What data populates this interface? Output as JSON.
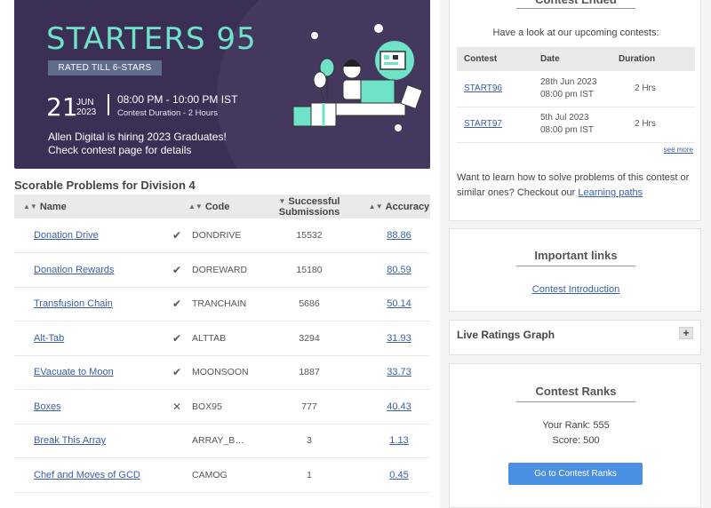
{
  "banner": {
    "title": "STARTERS 95",
    "rated_badge": "RATED TILL 6-STARS",
    "day": "21",
    "month": "JUN",
    "year": "2023",
    "time_range": "08:00 PM - 10:00 PM IST",
    "duration": "Contest Duration - 2 Hours",
    "hiring_line1": "Allen Digital is hiring 2023 Graduates!",
    "hiring_line2": "Check contest page for details"
  },
  "problems": {
    "section_title": "Scorable Problems for Division 4",
    "headers": {
      "name": "Name",
      "code": "Code",
      "submissions": "Successful Submissions",
      "accuracy": "Accuracy"
    },
    "rows": [
      {
        "name": "Donation Drive",
        "status": "✔",
        "code": "DONDRIVE",
        "subs": "15532",
        "acc": "88.86"
      },
      {
        "name": "Donation Rewards",
        "status": "✔",
        "code": "DOREWARD",
        "subs": "15180",
        "acc": "80.59"
      },
      {
        "name": "Transfusion Chain",
        "status": "✔",
        "code": "TRANCHAIN",
        "subs": "5686",
        "acc": "50.14"
      },
      {
        "name": "Alt-Tab",
        "status": "✔",
        "code": "ALTTAB",
        "subs": "3294",
        "acc": "31.93"
      },
      {
        "name": "EVacuate to Moon",
        "status": "✔",
        "code": "MOONSOON",
        "subs": "1887",
        "acc": "33.73"
      },
      {
        "name": "Boxes",
        "status": "✕",
        "code": "BOX95",
        "subs": "777",
        "acc": "40.43"
      },
      {
        "name": "Break This Array",
        "status": "",
        "code": "ARRAY_B…",
        "subs": "3",
        "acc": "1.13"
      },
      {
        "name": "Chef and Moves of GCD",
        "status": "",
        "code": "CAMOG",
        "subs": "1",
        "acc": "0.45"
      }
    ]
  },
  "ended": {
    "title": "Contest Ended",
    "upcoming_text": "Have a look at our upcoming contests:",
    "headers": {
      "contest": "Contest",
      "date": "Date",
      "duration": "Duration"
    },
    "rows": [
      {
        "contest": "START96",
        "date": "28th Jun 2023",
        "time": "08:00 pm IST",
        "duration": "2 Hrs"
      },
      {
        "contest": "START97",
        "date": "5th Jul 2023",
        "time": "08:00 pm IST",
        "duration": "2 Hrs"
      }
    ],
    "see_more": "see more",
    "learn_text": "Want to learn how to solve problems of this contest or similar ones? Checkout our ",
    "learn_link": "Learning paths"
  },
  "links": {
    "title": "Important links",
    "contest_intro": "Contest Introduction"
  },
  "graph": {
    "title": "Live Ratings Graph",
    "toggle": "+"
  },
  "ranks": {
    "title": "Contest Ranks",
    "your_rank": "Your Rank: 555",
    "score": "Score: 500",
    "button": "Go to Contest Ranks"
  }
}
